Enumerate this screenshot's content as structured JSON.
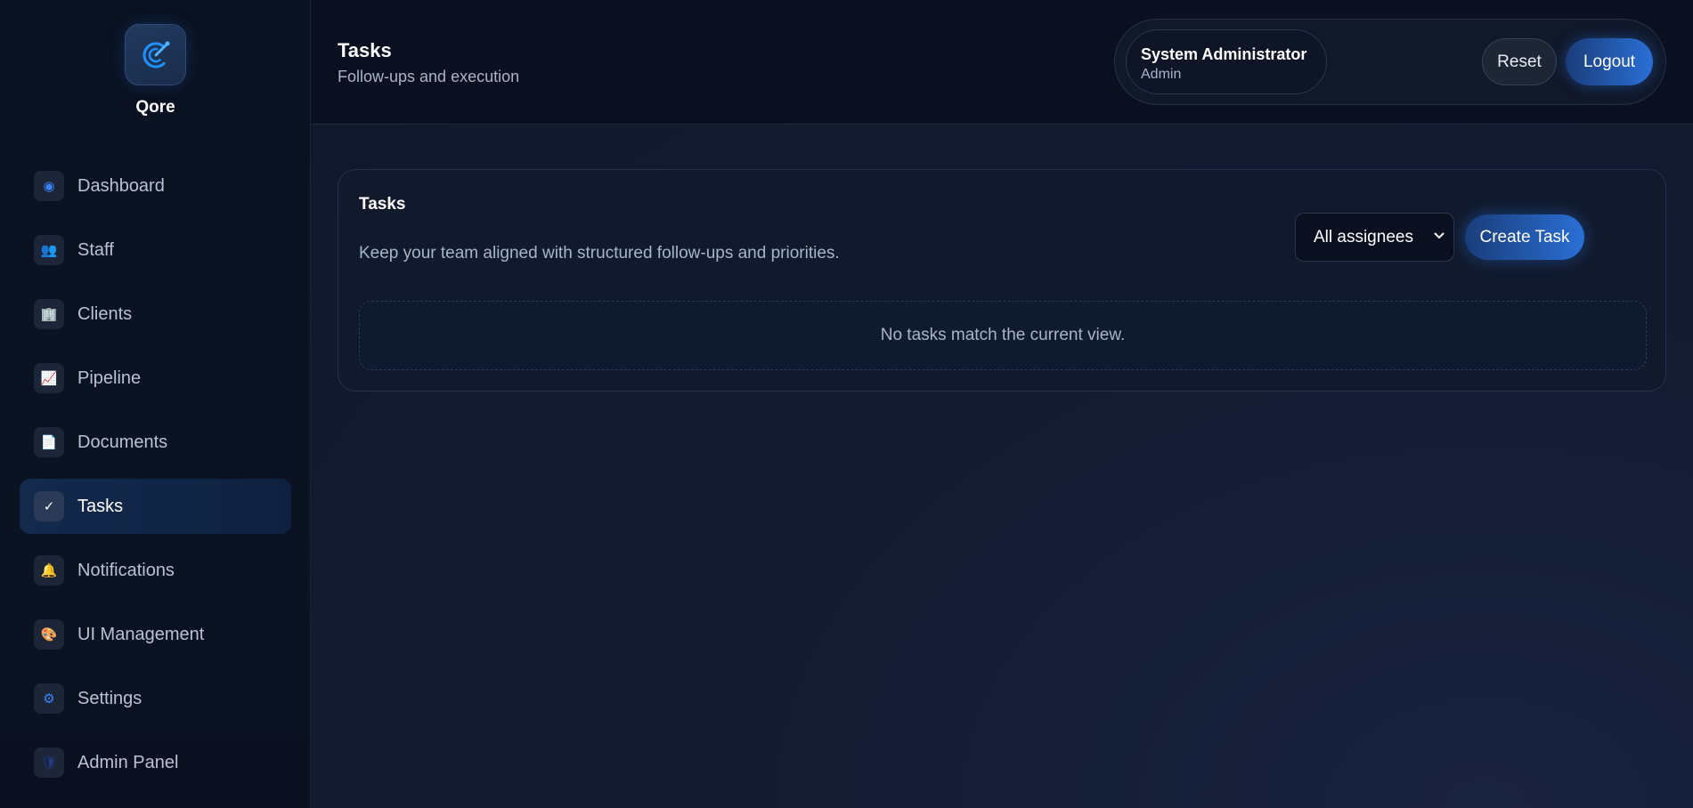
{
  "brand": {
    "name": "Qore",
    "logo_icon": "compass-icon"
  },
  "sidebar": {
    "items": [
      {
        "label": "Dashboard",
        "icon": "dashboard-icon",
        "glyph": "◉",
        "color": "#3b82f6",
        "active": false
      },
      {
        "label": "Staff",
        "icon": "staff-icon",
        "glyph": "👥",
        "color": "#8b5cf6",
        "active": false
      },
      {
        "label": "Clients",
        "icon": "clients-icon",
        "glyph": "🏢",
        "color": "#60a5fa",
        "active": false
      },
      {
        "label": "Pipeline",
        "icon": "pipeline-icon",
        "glyph": "📈",
        "color": "#ef4444",
        "active": false
      },
      {
        "label": "Documents",
        "icon": "documents-icon",
        "glyph": "📄",
        "color": "#e5e7eb",
        "active": false
      },
      {
        "label": "Tasks",
        "icon": "check-icon",
        "glyph": "✓",
        "color": "#ffffff",
        "active": true
      },
      {
        "label": "Notifications",
        "icon": "bell-icon",
        "glyph": "🔔",
        "color": "#f59e0b",
        "active": false
      },
      {
        "label": "UI Management",
        "icon": "palette-icon",
        "glyph": "🎨",
        "color": "#f97316",
        "active": false
      },
      {
        "label": "Settings",
        "icon": "gear-icon",
        "glyph": "⚙",
        "color": "#3b82f6",
        "active": false
      },
      {
        "label": "Admin Panel",
        "icon": "shield-icon",
        "glyph": "🛡",
        "color": "#1e3a8a",
        "active": false
      }
    ]
  },
  "header": {
    "title": "Tasks",
    "subtitle": "Follow-ups and execution",
    "user": {
      "name": "System Administrator",
      "role": "Admin"
    },
    "reset_label": "Reset",
    "logout_label": "Logout"
  },
  "card": {
    "title": "Tasks",
    "description": "Keep your team aligned with structured follow-ups and priorities.",
    "assignee_filter": {
      "selected": "All assignees"
    },
    "create_label": "Create Task",
    "empty_message": "No tasks match the current view."
  },
  "colors": {
    "accent": "#2a6fd6",
    "background": "#0b1222",
    "sidebar_active": "#132a4d"
  }
}
